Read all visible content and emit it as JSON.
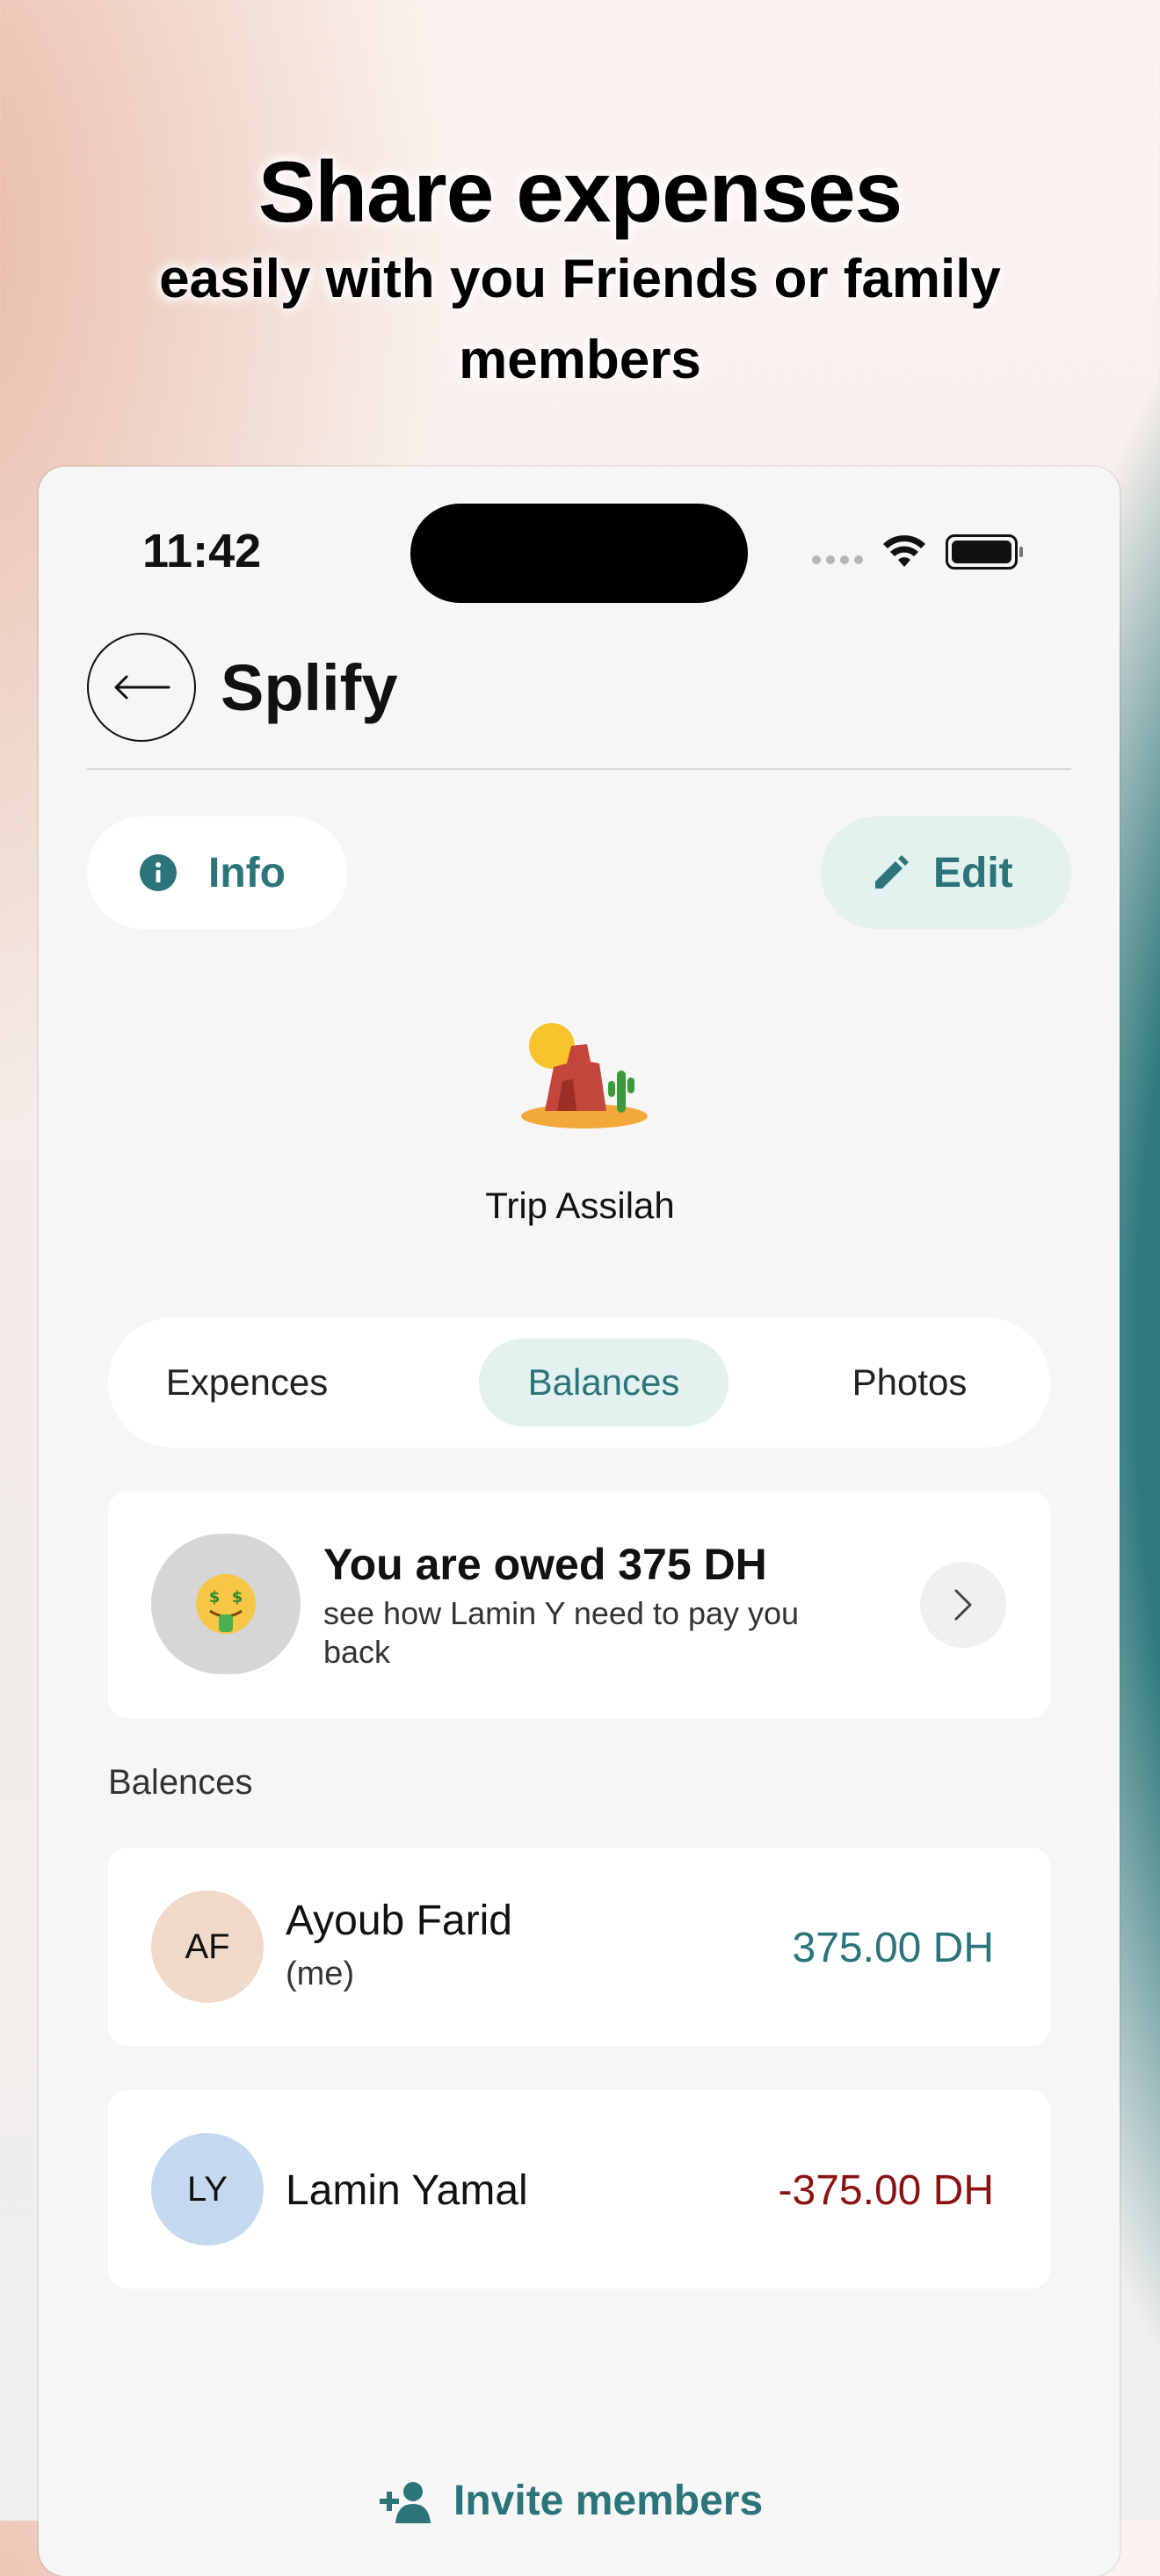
{
  "hero": {
    "title": "Share expenses",
    "subtitle": "easily with you Friends or family members"
  },
  "status_bar": {
    "time": "11:42"
  },
  "nav": {
    "title": "Splify"
  },
  "actions": {
    "info_label": "Info",
    "edit_label": "Edit"
  },
  "group": {
    "name": "Trip Assilah",
    "icon": "desert-emoji"
  },
  "tabs": [
    {
      "label": "Expences",
      "active": false
    },
    {
      "label": "Balances",
      "active": true
    },
    {
      "label": "Photos",
      "active": false
    }
  ],
  "summary": {
    "title": "You are owed 375 DH",
    "subtitle": "see how Lamin Y need to pay you back",
    "icon": "money-mouth-face-emoji"
  },
  "balances": {
    "label": "Balences",
    "items": [
      {
        "initials": "AF",
        "name": "Ayoub Farid",
        "note": "(me)",
        "amount": "375.00 DH",
        "avatar_color": "#f0d9c8",
        "amount_color": "#2a747a"
      },
      {
        "initials": "LY",
        "name": "Lamin Yamal",
        "note": "",
        "amount": "-375.00 DH",
        "avatar_color": "#c4d9f0",
        "amount_color": "#8b1212"
      }
    ]
  },
  "invite": {
    "label": "Invite members"
  },
  "colors": {
    "accent": "#2a747a",
    "accent_soft": "#e3f1ef",
    "negative": "#8b1212"
  }
}
